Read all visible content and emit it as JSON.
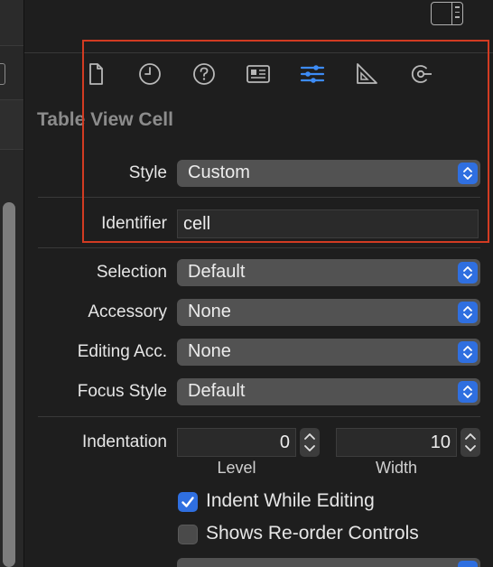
{
  "inspector": {
    "tabs": [
      {
        "name": "file-inspector",
        "icon": "document-icon",
        "active": false
      },
      {
        "name": "history-inspector",
        "icon": "clock-icon",
        "active": false
      },
      {
        "name": "quick-help",
        "icon": "question-icon",
        "active": false
      },
      {
        "name": "identity-inspector",
        "icon": "id-card-icon",
        "active": false
      },
      {
        "name": "attributes-inspector",
        "icon": "sliders-icon",
        "active": true
      },
      {
        "name": "size-inspector",
        "icon": "ruler-icon",
        "active": false
      },
      {
        "name": "connections-inspector",
        "icon": "connection-icon",
        "active": false
      }
    ],
    "section_title": "Table View Cell",
    "style": {
      "label": "Style",
      "value": "Custom"
    },
    "identifier": {
      "label": "Identifier",
      "value": "cell"
    },
    "selection": {
      "label": "Selection",
      "value": "Default"
    },
    "accessory": {
      "label": "Accessory",
      "value": "None"
    },
    "editing_acc": {
      "label": "Editing Acc.",
      "value": "None"
    },
    "focus_style": {
      "label": "Focus Style",
      "value": "Default"
    },
    "indentation": {
      "label": "Indentation",
      "level": {
        "value": "0",
        "caption": "Level"
      },
      "width": {
        "value": "10",
        "caption": "Width"
      }
    },
    "indent_while_editing": {
      "label": "Indent While Editing",
      "checked": true
    },
    "shows_reorder": {
      "label": "Shows Re-order Controls",
      "checked": false
    }
  },
  "colors": {
    "accent": "#2f6fe0",
    "highlight_box": "#d23b22",
    "background": "#1e1e1e"
  }
}
